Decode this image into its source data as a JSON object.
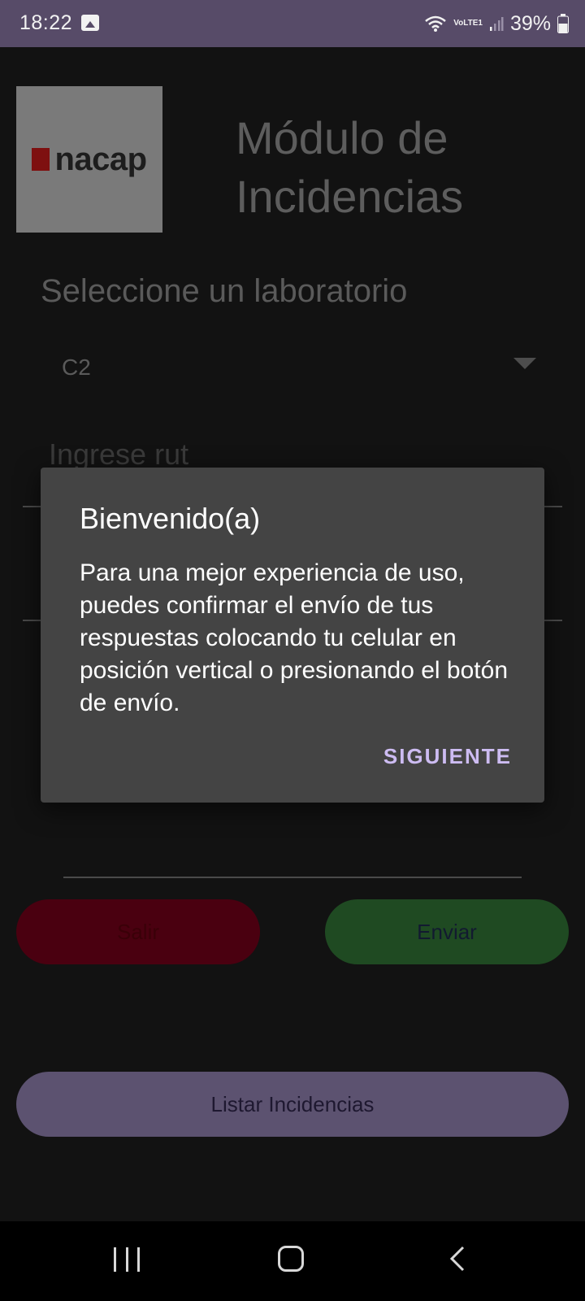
{
  "status_bar": {
    "time": "18:22",
    "network_label": "VoLTE1",
    "battery": "39%"
  },
  "app": {
    "logo_text": "nacap",
    "title": "Módulo de Incidencias",
    "select_label": "Seleccione un laboratorio",
    "select_value": "C2",
    "rut_placeholder": "Ingrese rut",
    "exit_button": "Salir",
    "send_button": "Enviar",
    "list_button": "Listar Incidencias"
  },
  "dialog": {
    "title": "Bienvenido(a)",
    "body": "Para una mejor experiencia de uso, puedes confirmar el envío de tus respuestas colocando tu celular en posición vertical o presionando el botón de envío.",
    "action": "SIGUIENTE"
  },
  "colors": {
    "status_bar": "#574b68",
    "dialog_bg": "#444444",
    "dialog_action": "#cdbcf2",
    "exit_button": "#4a0010",
    "send_button": "#1f4a22",
    "list_button": "#5c5270"
  }
}
